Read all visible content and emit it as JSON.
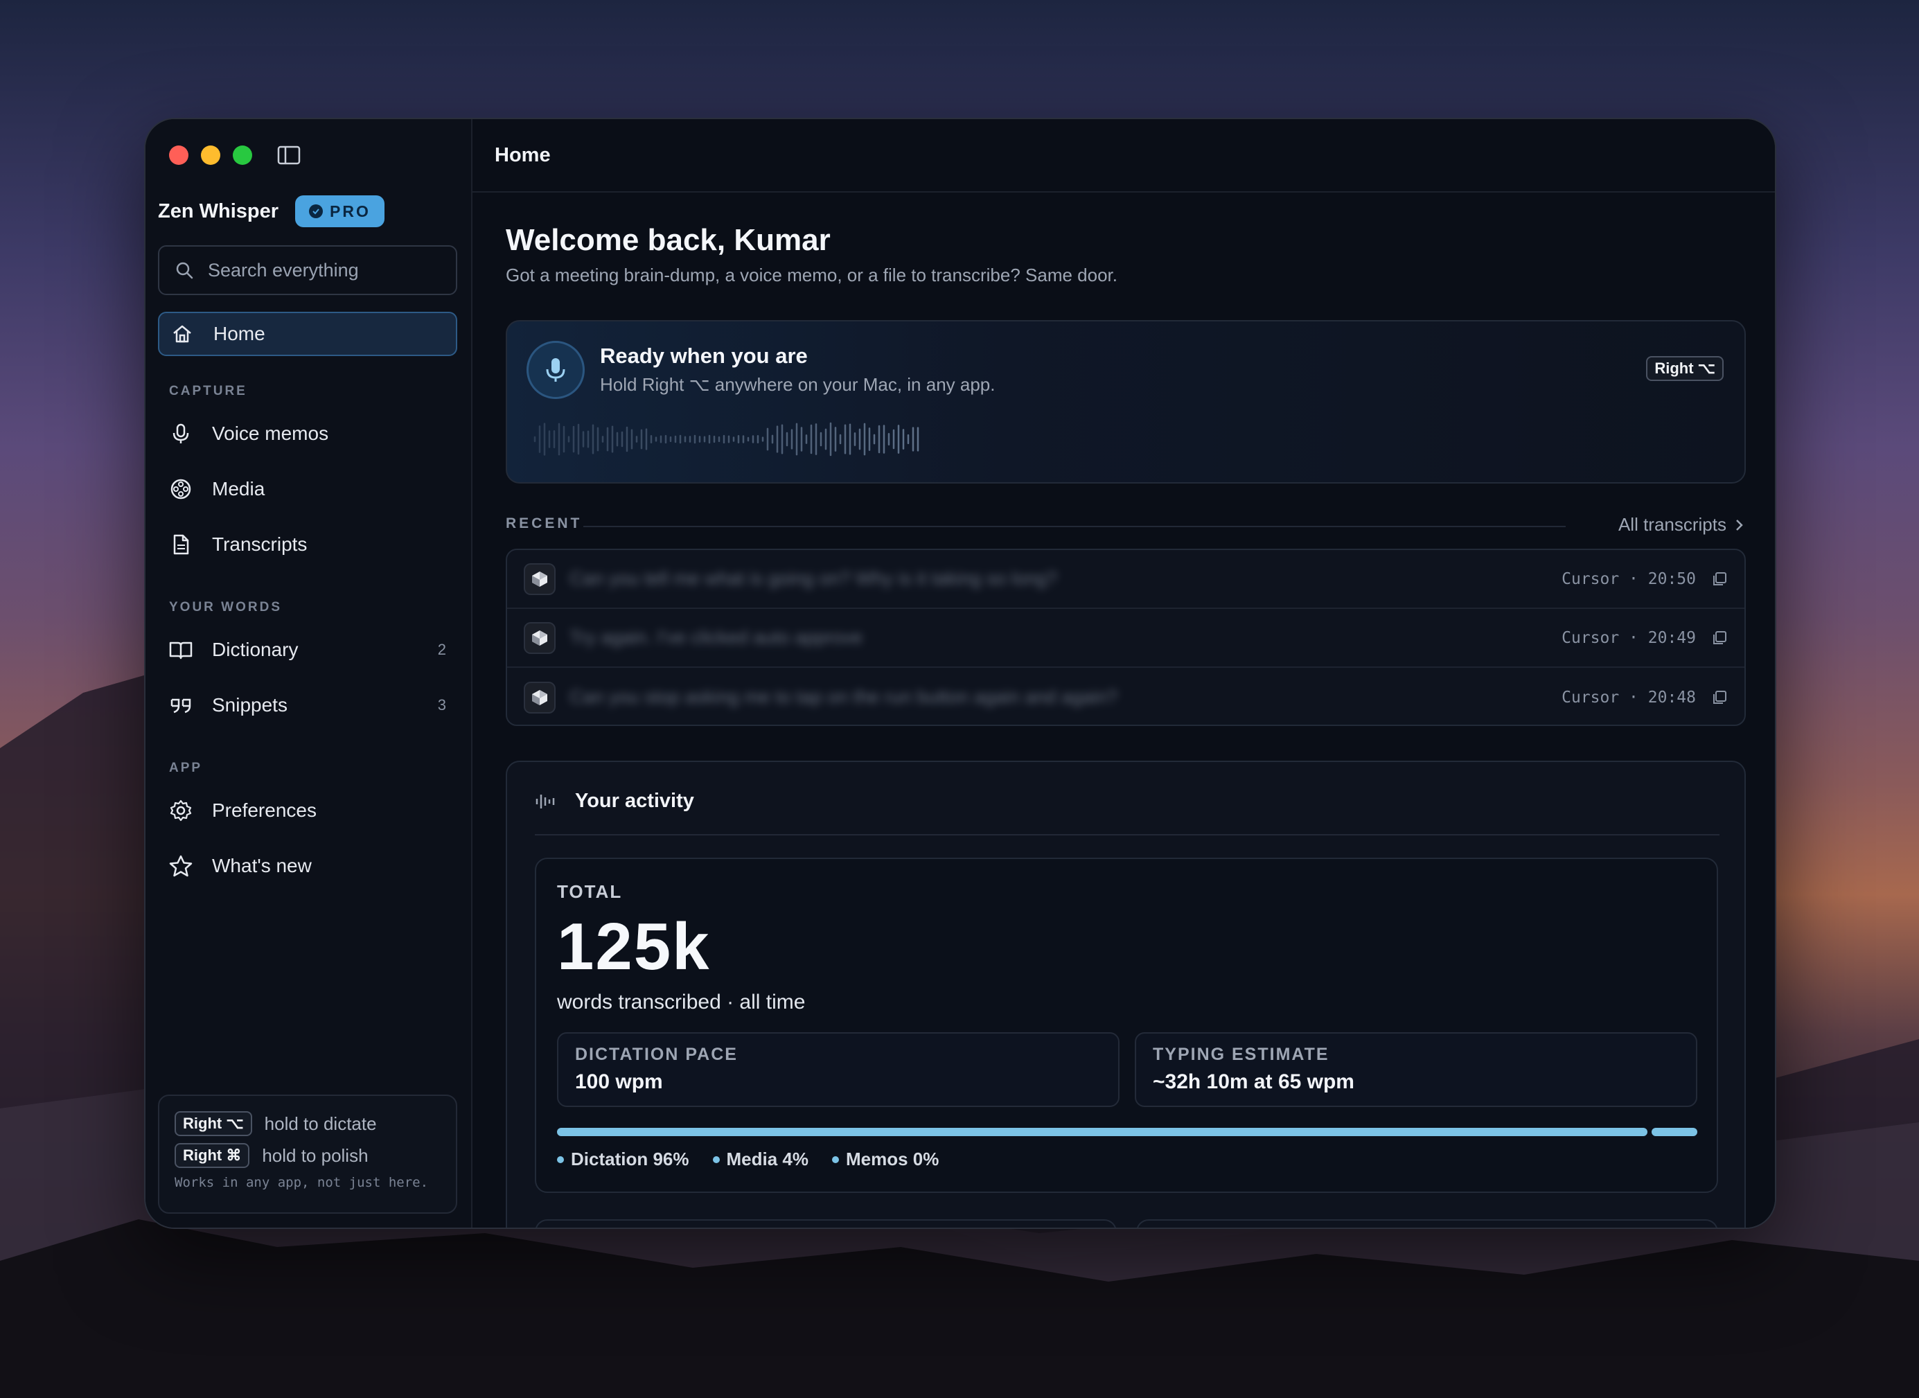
{
  "colors": {
    "accent": "#4aa3e0",
    "bar": "#7cc3e6",
    "window_bg": "#0a0e17"
  },
  "sidebar": {
    "app_name": "Zen Whisper",
    "badge": "PRO",
    "search_placeholder": "Search everything",
    "home_label": "Home",
    "sections": {
      "capture": "CAPTURE",
      "your_words": "YOUR WORDS",
      "app": "APP"
    },
    "items": {
      "voice_memos": "Voice memos",
      "media": "Media",
      "transcripts": "Transcripts",
      "dictionary": "Dictionary",
      "dictionary_count": "2",
      "snippets": "Snippets",
      "snippets_count": "3",
      "preferences": "Preferences",
      "whats_new": "What's new"
    },
    "hints": {
      "dictate_key": "Right ⌥",
      "dictate_text": "hold to dictate",
      "polish_key": "Right ⌘",
      "polish_text": "hold to polish",
      "footer": "Works in any app, not just here."
    }
  },
  "header": {
    "title": "Home"
  },
  "main": {
    "welcome": "Welcome back, Kumar",
    "subtitle": "Got a meeting brain-dump, a voice memo, or a file to transcribe? Same door.",
    "ready": {
      "title": "Ready when you are",
      "subtitle": "Hold Right ⌥ anywhere on your Mac, in any app.",
      "key": "Right ⌥"
    },
    "recent": {
      "label": "RECENT",
      "all_link": "All transcripts",
      "rows": [
        {
          "text": "Can you tell me what is going on? Why is it taking so long?",
          "meta": "Cursor · 20:50"
        },
        {
          "text": "Try again. I've clicked auto approve",
          "meta": "Cursor · 20:49"
        },
        {
          "text": "Can you stop asking me to tap on the run button again and again?",
          "meta": "Cursor · 20:48"
        }
      ]
    },
    "activity": {
      "title": "Your activity",
      "total_label": "TOTAL",
      "total_value": "125k",
      "total_sub": "words transcribed · all time",
      "pace_label": "DICTATION PACE",
      "pace_value": "100 wpm",
      "typing_label": "TYPING ESTIMATE",
      "typing_value": "~32h 10m at 65 wpm",
      "breakdown": [
        {
          "label": "Dictation 96%",
          "fraction": 0.96
        },
        {
          "label": "Media 4%",
          "fraction": 0.04
        },
        {
          "label": "Memos 0%",
          "fraction": 0.0
        }
      ]
    }
  }
}
